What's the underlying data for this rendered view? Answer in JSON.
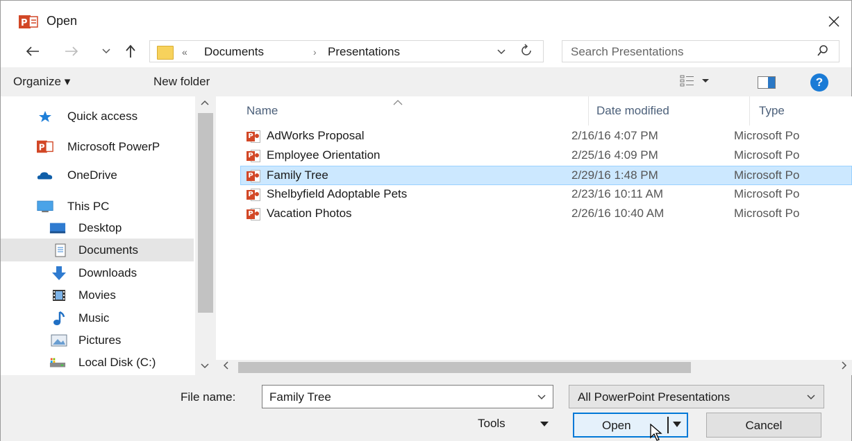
{
  "window": {
    "title": "Open",
    "close_icon": "✕"
  },
  "address_bar": {
    "chevron": "«",
    "crumbs": [
      "Documents",
      "Presentations"
    ],
    "separator": "›"
  },
  "search": {
    "placeholder": "Search Presentations"
  },
  "toolbar": {
    "organize_label": "Organize ▾",
    "new_folder_label": "New folder",
    "help_label": "?"
  },
  "nav_pane": {
    "items": [
      {
        "label": "Quick access",
        "icon": "star-icon"
      },
      {
        "label": "Microsoft PowerP",
        "icon": "powerpoint-icon"
      },
      {
        "label": "OneDrive",
        "icon": "cloud-icon"
      },
      {
        "label": "This PC",
        "icon": "computer-icon"
      },
      {
        "label": "Desktop",
        "icon": "desktop-icon"
      },
      {
        "label": "Documents",
        "icon": "documents-icon"
      },
      {
        "label": "Downloads",
        "icon": "download-icon"
      },
      {
        "label": "Movies",
        "icon": "film-icon"
      },
      {
        "label": "Music",
        "icon": "music-icon"
      },
      {
        "label": "Pictures",
        "icon": "pictures-icon"
      },
      {
        "label": "Local Disk (C:)",
        "icon": "disk-icon"
      }
    ],
    "selected": "Documents"
  },
  "file_list": {
    "columns": [
      "Name",
      "Date modified",
      "Type"
    ],
    "rows": [
      {
        "name": "AdWorks Proposal",
        "date": "2/16/16 4:07 PM",
        "type": "Microsoft Po"
      },
      {
        "name": "Employee Orientation",
        "date": "2/25/16 4:09 PM",
        "type": "Microsoft Po"
      },
      {
        "name": "Family Tree",
        "date": "2/29/16 1:48 PM",
        "type": "Microsoft Po"
      },
      {
        "name": "Shelbyfield Adoptable Pets",
        "date": "2/23/16 10:11 AM",
        "type": "Microsoft Po"
      },
      {
        "name": "Vacation Photos",
        "date": "2/26/16 10:40 AM",
        "type": "Microsoft Po"
      }
    ],
    "selected_row": "Family Tree"
  },
  "bottom": {
    "file_name_label": "File name:",
    "file_name_value": "Family Tree",
    "file_type_value": "All PowerPoint Presentations",
    "tools_label": "Tools",
    "open_label": "Open",
    "cancel_label": "Cancel"
  },
  "colors": {
    "accent": "#0078d7",
    "selection": "#cce8ff",
    "powerpoint": "#d24726"
  }
}
